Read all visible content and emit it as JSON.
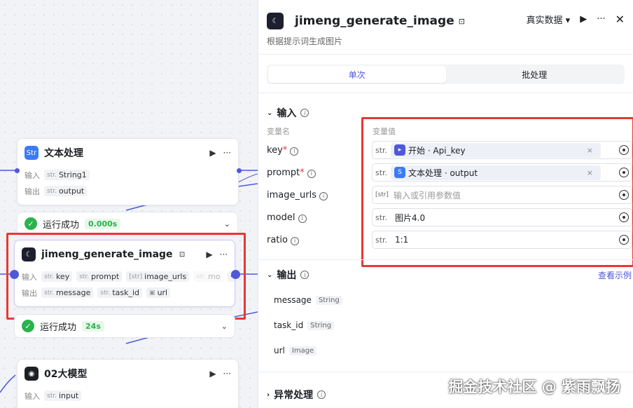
{
  "canvas": {
    "node_text": {
      "title": "文本处理",
      "icon": "text-process-icon",
      "input_label": "输入",
      "input_chip": {
        "type": "str.",
        "name": "String1"
      },
      "output_label": "输出",
      "output_chip": {
        "type": "str.",
        "name": "output"
      }
    },
    "status_text": {
      "label": "运行成功",
      "time": "0.000s"
    },
    "node_jimeng": {
      "title": "jimeng_generate_image",
      "input_label": "输入",
      "inputs": [
        {
          "type": "str.",
          "name": "key"
        },
        {
          "type": "str.",
          "name": "prompt"
        },
        {
          "type": "[str]",
          "name": "image_urls"
        },
        {
          "type": "str.",
          "name": "mo"
        }
      ],
      "more": "···",
      "output_label": "输出",
      "outputs": [
        {
          "type": "str.",
          "name": "message"
        },
        {
          "type": "str.",
          "name": "task_id"
        },
        {
          "type": "img",
          "name": "url"
        }
      ]
    },
    "status_jimeng": {
      "label": "运行成功",
      "time": "24s"
    },
    "node_llm": {
      "title": "02大模型",
      "input_label": "输入",
      "input_chip": {
        "type": "str.",
        "name": "input"
      }
    }
  },
  "panel": {
    "title": "jimeng_generate_image",
    "subtitle": "根据提示词生成图片",
    "data_mode": "真实数据",
    "tabs": [
      {
        "label": "单次",
        "active": true
      },
      {
        "label": "批处理",
        "active": false
      }
    ],
    "input_section": "输入",
    "col_name": "变量名",
    "col_value": "变量值",
    "params": [
      {
        "name": "key",
        "required": true,
        "type": "str.",
        "ref": "开始 · Api_key",
        "ref_icon": "start-icon"
      },
      {
        "name": "prompt",
        "required": true,
        "type": "str.",
        "ref": "文本处理 · output",
        "ref_icon": "text-process-icon"
      },
      {
        "name": "image_urls",
        "required": false,
        "type": "[str]",
        "placeholder": "输入或引用参数值"
      },
      {
        "name": "model",
        "required": false,
        "type": "str.",
        "value": "图片4.0"
      },
      {
        "name": "ratio",
        "required": false,
        "type": "str.",
        "value": "1:1"
      }
    ],
    "output_section": "输出",
    "view_example": "查看示例",
    "outputs": [
      {
        "name": "message",
        "type": "String"
      },
      {
        "name": "task_id",
        "type": "String"
      },
      {
        "name": "url",
        "type": "Image"
      }
    ],
    "exception_section": "异常处理"
  },
  "watermark": "掘金技术社区 @ 紫雨飘扬",
  "colors": {
    "accent": "#4e58d8",
    "success": "#2bb24c",
    "highlight": "#e53935"
  }
}
